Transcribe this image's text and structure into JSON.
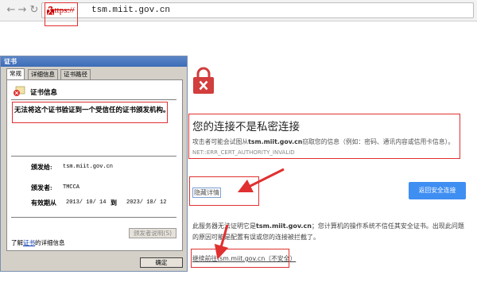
{
  "toolbar": {
    "back_icon": "arrow-left-icon",
    "forward_icon": "arrow-right-icon",
    "reload_icon": "reload-icon",
    "url_scheme": "https://",
    "url_host": "tsm.miit.gov.cn"
  },
  "cert_dialog": {
    "title": "证书",
    "tabs": [
      "常规",
      "详细信息",
      "证书路径"
    ],
    "info_title": "证书信息",
    "warning": "无法将这个证书验证到一个受信任的证书颁发机构。",
    "issued_to_label": "颁发给:",
    "issued_to_value": "tsm.miit.gov.cn",
    "issued_by_label": "颁发者:",
    "issued_by_value": "TMCCA",
    "validity_label": "有效期从",
    "valid_from": "2013/ 10/ 14",
    "validity_to_word": "到",
    "valid_to": "2023/ 10/ 12",
    "issuer_statement_button": "颁发者说明(S)",
    "learn_prefix": "了解",
    "learn_link": "证书",
    "learn_suffix": "的详细信息",
    "ok_button": "确定"
  },
  "error_page": {
    "heading": "您的连接不是私密连接",
    "desc_prefix": "攻击者可能会试图从",
    "desc_host": "tsm.miit.gov.cn",
    "desc_suffix": "窃取您的信息（例如：密码、通讯内容或信用卡信息）。",
    "error_code": "NET::ERR_CERT_AUTHORITY_INVALID",
    "hide_details": "隐藏详情",
    "back_button": "返回安全连接",
    "explain_prefix": "此服务器无法证明它是",
    "explain_host": "tsm.miit.gov.cn",
    "explain_suffix": "；您计算机的操作系统不信任其安全证书。出现此问题的原因可能是配置有误或您的连接被拦截了。",
    "proceed_link": "继续前往tsm.miit.gov.cn（不安全）"
  },
  "colors": {
    "annotation_red": "#e03030",
    "button_blue": "#3f8ef2",
    "lock_red": "#d23d3d"
  }
}
